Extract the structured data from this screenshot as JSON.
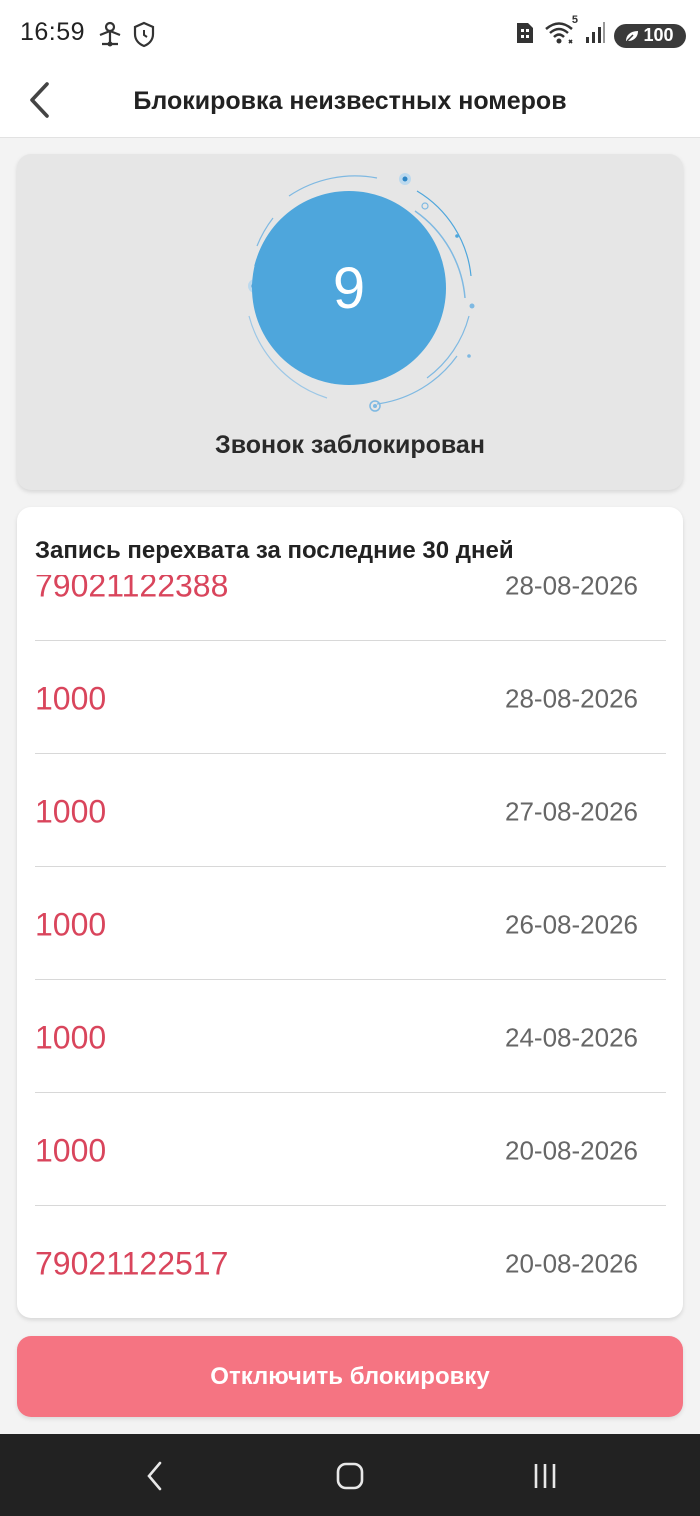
{
  "status_bar": {
    "time": "16:59",
    "battery": "100",
    "wifi_label": "5",
    "icons_left": [
      "network-share-icon",
      "shield-icon"
    ],
    "icons_right": [
      "sim-icon",
      "wifi-icon",
      "signal-icon",
      "battery-icon"
    ]
  },
  "header": {
    "title": "Блокировка неизвестных номеров",
    "back_icon": "chevron-left-icon"
  },
  "counter": {
    "value": "9",
    "status": "Звонок заблокирован",
    "circle_color": "#4ea6dc"
  },
  "log": {
    "title": "Запись перехвата за последние 30 дней",
    "items": [
      {
        "number": "79021122388",
        "date": "28-08-2026"
      },
      {
        "number": "1000",
        "date": "28-08-2026"
      },
      {
        "number": "1000",
        "date": "27-08-2026"
      },
      {
        "number": "1000",
        "date": "26-08-2026"
      },
      {
        "number": "1000",
        "date": "24-08-2026"
      },
      {
        "number": "1000",
        "date": "20-08-2026"
      },
      {
        "number": "79021122517",
        "date": "20-08-2026"
      }
    ]
  },
  "actions": {
    "disable_label": "Отключить блокировку"
  },
  "nav": {
    "icons": [
      "back-nav-icon",
      "home-nav-icon",
      "recents-nav-icon"
    ]
  },
  "colors": {
    "accent_red": "#d9455c",
    "button_red": "#f57482",
    "circle_blue": "#4ea6dc"
  }
}
